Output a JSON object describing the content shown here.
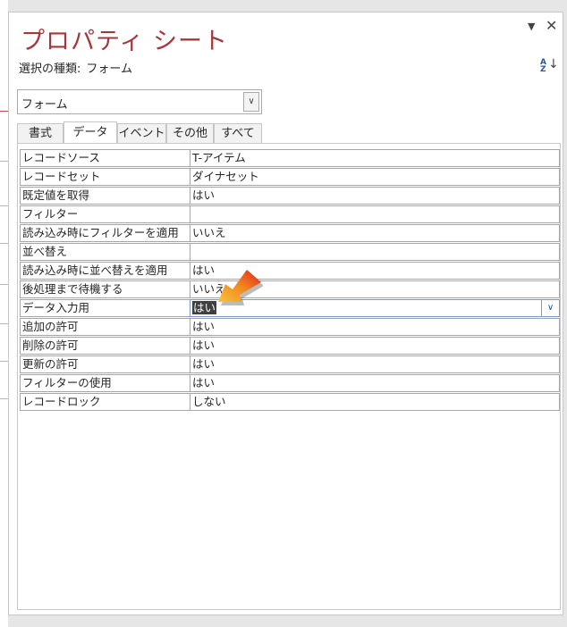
{
  "pane": {
    "title": "プロパティ シート",
    "selection_type_label": "選択の種類:",
    "selection_type_value": "フォーム",
    "object_select_value": "フォーム",
    "menu_glyph": "▼",
    "close_glyph": "✕",
    "sort_glyph_a": "A",
    "sort_glyph_z": "Z",
    "sort_arrow": "↓"
  },
  "tabs": [
    "書式",
    "データ",
    "イベント",
    "その他",
    "すべて"
  ],
  "active_tab": "データ",
  "properties": [
    {
      "name": "レコードソース",
      "value": "T-アイテム"
    },
    {
      "name": "レコードセット",
      "value": "ダイナセット"
    },
    {
      "name": "既定値を取得",
      "value": "はい"
    },
    {
      "name": "フィルター",
      "value": ""
    },
    {
      "name": "読み込み時にフィルターを適用",
      "value": "いいえ"
    },
    {
      "name": "並べ替え",
      "value": ""
    },
    {
      "name": "読み込み時に並べ替えを適用",
      "value": "はい"
    },
    {
      "name": "後処理まで待機する",
      "value": "いいえ"
    },
    {
      "name": "データ入力用",
      "value": "はい"
    },
    {
      "name": "追加の許可",
      "value": "はい"
    },
    {
      "name": "削除の許可",
      "value": "はい"
    },
    {
      "name": "更新の許可",
      "value": "はい"
    },
    {
      "name": "フィルターの使用",
      "value": "はい"
    },
    {
      "name": "レコードロック",
      "value": "しない"
    }
  ],
  "dropdown_glyph": "∨",
  "select_arrow_glyph": "∨",
  "colors": {
    "title": "#a4373a",
    "arrow_fill": "#f5a623",
    "arrow_tip": "#e02020"
  }
}
